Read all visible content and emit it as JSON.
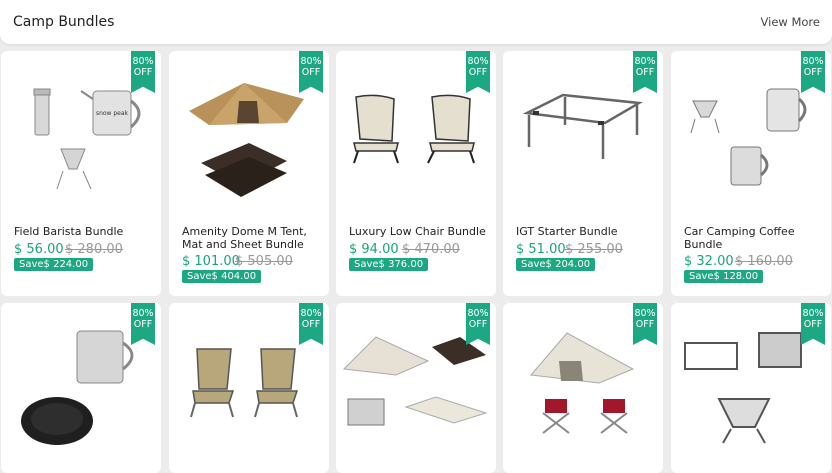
{
  "header": {
    "title": "Camp Bundles",
    "view_more": "View More"
  },
  "discount_label": [
    "80%",
    "OFF"
  ],
  "row1": [
    {
      "name": "Field Barista Bundle",
      "price": "$ 56.00",
      "old": "$ 280.00",
      "save": "Save$ 224.00"
    },
    {
      "name": "Amenity Dome M Tent, Mat and Sheet Bundle",
      "price": "$ 101.00",
      "old": "$ 505.00",
      "save": "Save$ 404.00"
    },
    {
      "name": "Luxury Low Chair Bundle",
      "price": "$ 94.00",
      "old": "$ 470.00",
      "save": "Save$ 376.00"
    },
    {
      "name": "IGT Starter Bundle",
      "price": "$ 51.00",
      "old": "$ 255.00",
      "save": "Save$ 204.00"
    },
    {
      "name": "Car Camping Coffee Bundle",
      "price": "$ 32.00",
      "old": "$ 160.00",
      "save": "Save$ 128.00"
    }
  ],
  "colors": {
    "accent": "#1ca882",
    "price": "#1aa57a"
  }
}
